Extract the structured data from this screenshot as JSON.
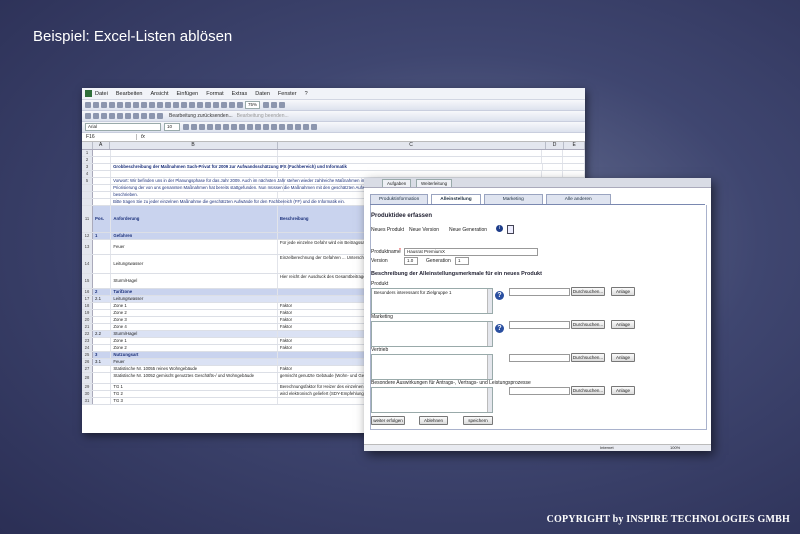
{
  "slide": {
    "title": "Beispiel: Excel-Listen ablösen",
    "copyright": "COPYRIGHT by INSPIRE TECHNOLOGIES GMBH"
  },
  "excel": {
    "menu": [
      "Datei",
      "Bearbeiten",
      "Ansicht",
      "Einfügen",
      "Format",
      "Extras",
      "Daten",
      "Fenster",
      "?"
    ],
    "zoom": "75%",
    "review_bar": [
      "Bearbeitung zurücksenden...",
      "Bearbeitung beenden..."
    ],
    "font": "Arial",
    "font_size": "10",
    "name_box": "F16",
    "columns": [
      "A",
      "B",
      "C",
      "D",
      "E"
    ],
    "rows": [
      {
        "n": "1",
        "a": "",
        "b": "",
        "c": ""
      },
      {
        "n": "2",
        "a": "",
        "b": "",
        "c": ""
      },
      {
        "n": "3",
        "a": "",
        "b": "Grobbeschreibung der Maßnahmen Sach-Privat für 2009 zur Aufwandsschätzung IFX (Fachbereich) und Informatik",
        "c": ""
      },
      {
        "n": "4",
        "a": "",
        "b": "",
        "c": ""
      },
      {
        "n": "5",
        "a": "",
        "b": "Vorwort: Wir befinden uns in der Planungsphase für das Jahr 2009. Auch im nächsten Jahr stehen wieder zahlreiche Maßnahmen im Sach-Privat an. Im ersten Schritt geht es um die Priorisierung und die Machbarkeit (Ressourcen). Die",
        "c": ""
      },
      {
        "n": "",
        "a": "",
        "b": "Priorisierung der von uns genannten Maßnahmen hat bereits stattgefunden. Nun müssen die Maßnahmen mit den geschätzten Aufwänden ...",
        "c": ""
      },
      {
        "n": "",
        "a": "",
        "b": "beschrieben.",
        "c": ""
      },
      {
        "n": "",
        "a": "",
        "b": "Bitte tragen Sie zu jeder einzelnen Maßnahme die geschätzten Aufwände für den Fachbereich (FF) und die Informatik ein.",
        "c": ""
      },
      {
        "n": "11",
        "a": "Pos.",
        "b": "Anforderung",
        "c": "Beschreibung"
      },
      {
        "n": "12",
        "a": "1",
        "b": "Gefahren",
        "c": ""
      },
      {
        "n": "13",
        "a": "",
        "b": "Feuer",
        "c": "Für jede einzelne Gefahr wird ein Beitragssatz ..."
      },
      {
        "n": "14",
        "a": "",
        "b": "Leitungswasser",
        "c": "Einzelberechnung der Gefahren ... Unterschiedliche Merkmale und oder gleiche ..."
      },
      {
        "n": "15",
        "a": "",
        "b": "Sturm/Hagel",
        "c": "Hier reicht der Ausdruck des Gesamtbeitrages ..."
      },
      {
        "n": "16",
        "a": "2",
        "b": "Tarifzone",
        "c": ""
      },
      {
        "n": "17",
        "a": "2.1",
        "b": "Leitungswasser",
        "c": ""
      },
      {
        "n": "18",
        "a": "",
        "b": "Zone 1",
        "c": "Faktor"
      },
      {
        "n": "19",
        "a": "",
        "b": "Zone 2",
        "c": "Faktor"
      },
      {
        "n": "20",
        "a": "",
        "b": "Zone 3",
        "c": "Faktor"
      },
      {
        "n": "21",
        "a": "",
        "b": "Zone 4",
        "c": "Faktor"
      },
      {
        "n": "22",
        "a": "2.2",
        "b": "Sturm/Hagel",
        "c": ""
      },
      {
        "n": "23",
        "a": "",
        "b": "Zone 1",
        "c": "Faktor"
      },
      {
        "n": "24",
        "a": "",
        "b": "Zone 2",
        "c": "Faktor"
      },
      {
        "n": "25",
        "a": "3",
        "b": "Nutzungsart",
        "c": ""
      },
      {
        "n": "26",
        "a": "3.1",
        "b": "Feuer",
        "c": ""
      },
      {
        "n": "27",
        "a": "",
        "b": "Statistische Nr. 10055 reines Wohngebäude",
        "c": "Faktor"
      },
      {
        "n": "28",
        "a": "",
        "b": "Statistische Nr. 10052 gemischt genutztes Geschäfts-/ und Wohngebäude",
        "c": "gemischt genutzte Gebäude (Wohn- und Gewerbe)"
      },
      {
        "n": "29",
        "a": "",
        "b": "TG 1",
        "c": "Berechnungsfaktor für Heizer des einzelnen Tarifs"
      },
      {
        "n": "30",
        "a": "",
        "b": "TG 2",
        "c": "wird elektronisch geliefert (SDY-Empfehlung)"
      },
      {
        "n": "31",
        "a": "",
        "b": "TG 3",
        "c": ""
      }
    ]
  },
  "form": {
    "top_tabs": [
      "Aufgaben",
      "Weiterleitung"
    ],
    "tabs": [
      "Produktinformation",
      "Alleinstellung",
      "Marketing",
      "Alle anderen"
    ],
    "active_tab": "Alleinstellung",
    "heading": "Produktidee erfassen",
    "radio_labels": [
      "Neues Produkt",
      "Neue Version",
      "Neue Generation"
    ],
    "product_name_label": "Produktname",
    "product_name_value": "Hausrat PremiumX",
    "version_label": "Version",
    "version_value": "1.0",
    "generation_label": "Generation",
    "generation_value": "1",
    "section_heading": "Beschreibung der Alleinstellungsmerkmale für ein neues Produkt",
    "fields": [
      {
        "label": "Produkt",
        "value": "Besonders interessant für Zielgruppe 1"
      },
      {
        "label": "Marketing",
        "value": ""
      },
      {
        "label": "Vertrieb",
        "value": ""
      },
      {
        "label": "Besondere Auswirkungen für Antrags-, Vertrags- und Leistungsprozesse",
        "value": ""
      }
    ],
    "browse_button": "Durchsuchen...",
    "attach_button": "Anlage",
    "footer_buttons": [
      "weiter erfolgen",
      "Ablehnen",
      "speichern"
    ],
    "status_zone": "Internet",
    "status_zoom": "100%"
  }
}
